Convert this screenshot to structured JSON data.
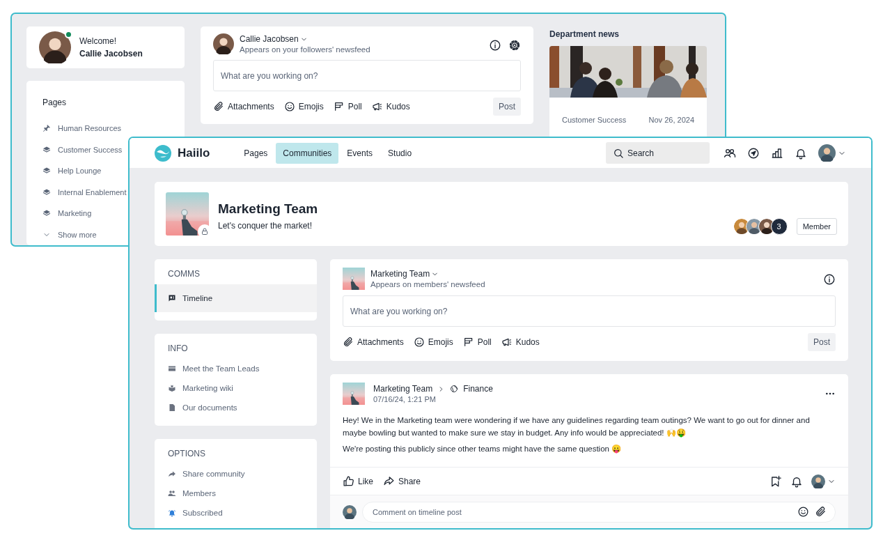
{
  "back_window": {
    "welcome": {
      "greeting": "Welcome!",
      "name": "Callie Jacobsen",
      "online": true
    },
    "pages": {
      "title": "Pages",
      "items": [
        {
          "label": "Human Resources",
          "kind": "pinned"
        },
        {
          "label": "Customer Success",
          "kind": "page"
        },
        {
          "label": "Help Lounge",
          "kind": "page"
        },
        {
          "label": "Internal Enablement",
          "kind": "page"
        },
        {
          "label": "Marketing",
          "kind": "page"
        }
      ],
      "show_more": "Show more"
    },
    "composer": {
      "author": "Callie Jacobsen",
      "kind": "person",
      "audience": "Appears on your followers' newsfeed",
      "settings": true,
      "placeholder": "What are you working on?",
      "actions": [
        {
          "label": "Attachments",
          "kind": "attach"
        },
        {
          "label": "Emojis",
          "kind": "emoji"
        },
        {
          "label": "Poll",
          "kind": "poll"
        },
        {
          "label": "Kudos",
          "kind": "kudos"
        }
      ],
      "post": "Post"
    },
    "news": {
      "title": "Department news",
      "category": "Customer Success",
      "date": "Nov 26, 2024"
    }
  },
  "app": {
    "brand": "Haiilo",
    "nav": [
      {
        "label": "Pages",
        "selected": false
      },
      {
        "label": "Communities",
        "selected": true
      },
      {
        "label": "Events",
        "selected": false
      },
      {
        "label": "Studio",
        "selected": false
      }
    ],
    "search": {
      "placeholder": "Search"
    },
    "community": {
      "name": "Marketing Team",
      "tagline": "Let's conquer the market!",
      "locked": true,
      "member_count": "3",
      "membership": "Member"
    },
    "sidebar": [
      {
        "title": "COMMS",
        "items": [
          {
            "label": "Timeline",
            "kind": "timeline",
            "selected": true
          }
        ]
      },
      {
        "title": "INFO",
        "items": [
          {
            "label": "Meet the Team Leads",
            "kind": "table",
            "selected": false
          },
          {
            "label": "Marketing wiki",
            "kind": "wiki",
            "selected": false
          },
          {
            "label": "Our documents",
            "kind": "document",
            "selected": false
          }
        ]
      },
      {
        "title": "OPTIONS",
        "items": [
          {
            "label": "Share community",
            "kind": "share",
            "selected": false,
            "active": false
          },
          {
            "label": "Members",
            "kind": "members",
            "selected": false,
            "active": false
          },
          {
            "label": "Subscribed",
            "kind": "bell",
            "selected": false,
            "active": true
          }
        ]
      }
    ],
    "composer": {
      "author": "Marketing Team",
      "kind": "community",
      "audience": "Appears on members' newsfeed",
      "placeholder": "What are you working on?",
      "actions": [
        {
          "label": "Attachments",
          "kind": "attach"
        },
        {
          "label": "Emojis",
          "kind": "emoji"
        },
        {
          "label": "Poll",
          "kind": "poll"
        },
        {
          "label": "Kudos",
          "kind": "kudos"
        }
      ],
      "post": "Post"
    },
    "post": {
      "author": "Marketing Team",
      "target": "Finance",
      "time": "07/16/24, 1:21 PM",
      "paragraphs": [
        "Hey! We in the Marketing team were wondering if we have any guidelines regarding team outings? We want to go out for dinner and maybe bowling but wanted to make sure we stay in budget. Any info would be appreciated! 🙌🤑",
        "We're posting this publicly since other teams might have the same question 😛"
      ],
      "actions": [
        {
          "label": "Like",
          "kind": "like"
        },
        {
          "label": "Share",
          "kind": "share"
        }
      ],
      "comment_placeholder": "Comment on timeline post"
    }
  }
}
